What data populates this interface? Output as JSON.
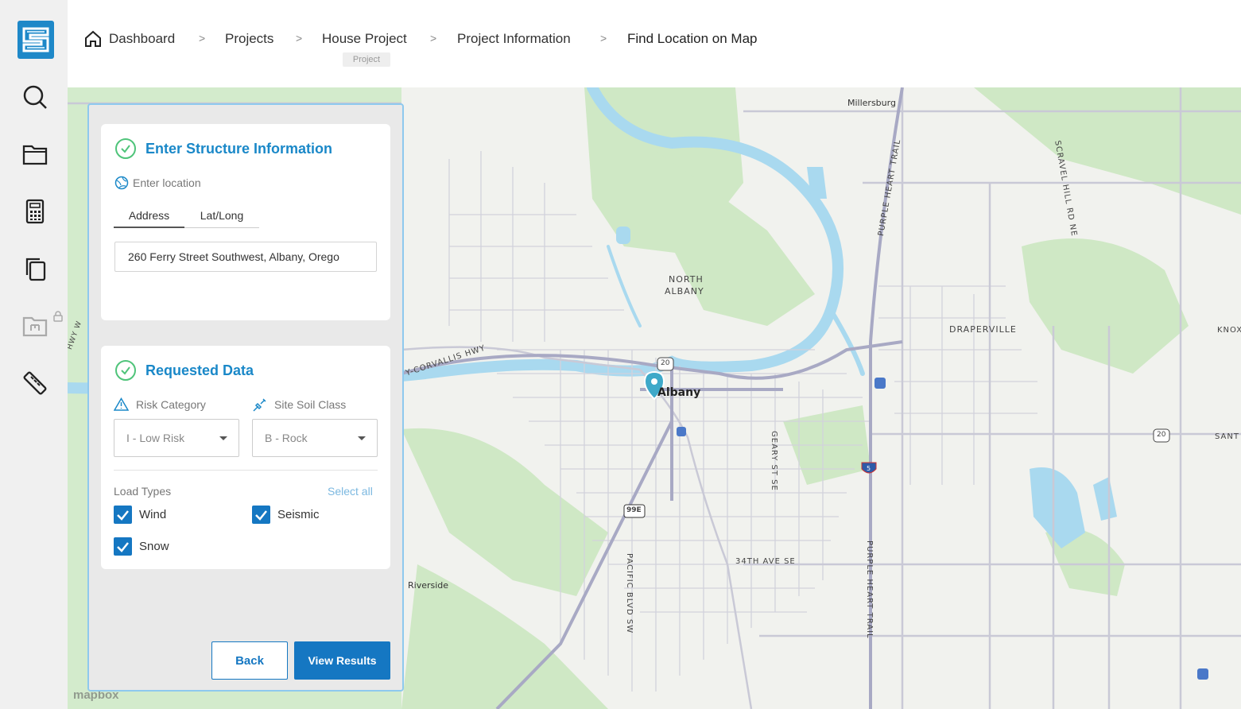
{
  "breadcrumb": {
    "items": [
      "Dashboard",
      "Projects",
      "House Project",
      "Project Information",
      "Find Location on Map"
    ],
    "separator": ">",
    "project_badge": "Project"
  },
  "sidebar": {
    "icons": [
      "search-icon",
      "folder-icon",
      "calculator-icon",
      "copy-icon",
      "locked-folder-icon",
      "ruler-icon"
    ]
  },
  "structure": {
    "title": "Enter Structure Information",
    "location_label": "Enter location",
    "tabs": [
      "Address",
      "Lat/Long"
    ],
    "active_tab": "Address",
    "address_value": "260 Ferry Street Southwest, Albany, Orego"
  },
  "requested": {
    "title": "Requested Data",
    "risk_label": "Risk Category",
    "risk_value": "I - Low Risk",
    "soil_label": "Site Soil Class",
    "soil_value": "B - Rock",
    "load_types_label": "Load Types",
    "select_all": "Select all",
    "loads": [
      {
        "label": "Wind",
        "checked": true
      },
      {
        "label": "Seismic",
        "checked": true
      },
      {
        "label": "Snow",
        "checked": true
      }
    ]
  },
  "buttons": {
    "back": "Back",
    "view_results": "View Results"
  },
  "map": {
    "labels": {
      "millersburg": "Millersburg",
      "north": "NORTH",
      "albany_n": "ALBANY",
      "draperville": "DRAPERVILLE",
      "albany": "Albany",
      "corvallis_hwy": "Y-CORVALLIS HWY",
      "riverside": "Riverside",
      "ave_34th": "34TH AVE SE",
      "geary": "GEARY ST SE",
      "pacific": "PACIFIC BLVD SW",
      "purple_heart_n": "PURPLE HEART TRAIL",
      "purple_heart_s": "PURPLE HEART TRAIL",
      "scravel": "SCRAVEL HILL RD NE",
      "knox": "KNOX",
      "sant": "SANT",
      "hwy20a": "20",
      "hwy20b": "20",
      "i5": "5",
      "hwy99e": "99E",
      "hwy_w": "HWY W"
    },
    "attribution": "mapbox",
    "colors": {
      "water": "#a9d9ef",
      "park": "#cfe8c5",
      "road": "#c9c9d6",
      "highway": "#a8a9c4",
      "pin": "#3ea9c9"
    }
  }
}
